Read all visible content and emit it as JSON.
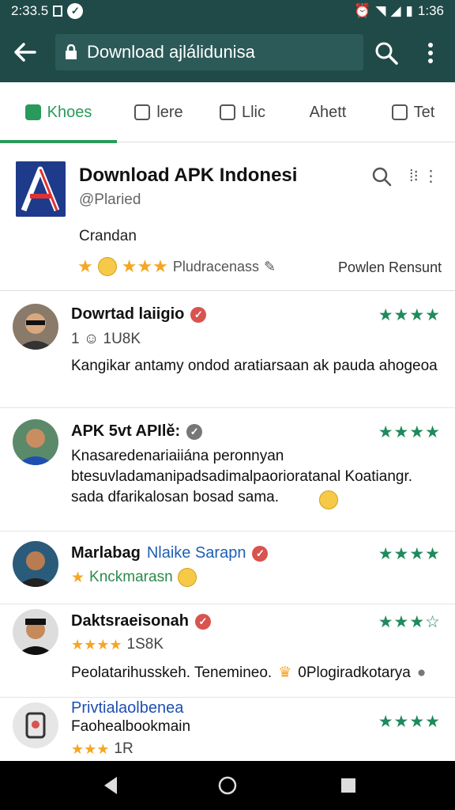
{
  "status": {
    "left_time": "2:33.5",
    "right_time": "1:36"
  },
  "toolbar": {
    "url": "Download ajlálidunisa"
  },
  "tabs": [
    {
      "label": "Khoes",
      "active": true
    },
    {
      "label": "lere",
      "active": false
    },
    {
      "label": "Llic",
      "active": false
    },
    {
      "label": "Ahett",
      "active": false
    },
    {
      "label": "Tet",
      "active": false
    }
  ],
  "app": {
    "title": "Download APK Indonesi",
    "handle": "@Plaried",
    "desc": "Crandan",
    "rating_text": "Pludracenass",
    "extra": "Powlen Rensunt",
    "more": "⁞⁝ ⋮"
  },
  "reviews": [
    {
      "name": "Dowrtad laiigio",
      "meta": "1 ☺ 1U8K",
      "text": "Kangikar antamy ondod aratiarsaan ak pauda ahogeoa",
      "stars": "★★★★"
    },
    {
      "name": "APK 5vt APIlě:",
      "meta": "",
      "text": "Knasaredenariaiiána peronnyan btesuvladamanipadsadimalpaorioratanal Koatiangr. sada dfarikalosan bosad sama.",
      "stars": "★★★★"
    },
    {
      "name": "Marlabag",
      "name_highlight": "Nlaike Sarapn",
      "meta": "Knckmarasn",
      "text": "",
      "stars": "★★★★"
    },
    {
      "name": "Daktsraeisonah",
      "meta": "1S8K",
      "text": "Peolatarihusskeh. Tenemineo.",
      "text_extra": "0Plogiradkotarya",
      "stars": "★★★☆"
    },
    {
      "name": "Privtialaolbenea",
      "meta": "1R",
      "text": "Faohealbookmain",
      "stars": "★★★★"
    }
  ]
}
